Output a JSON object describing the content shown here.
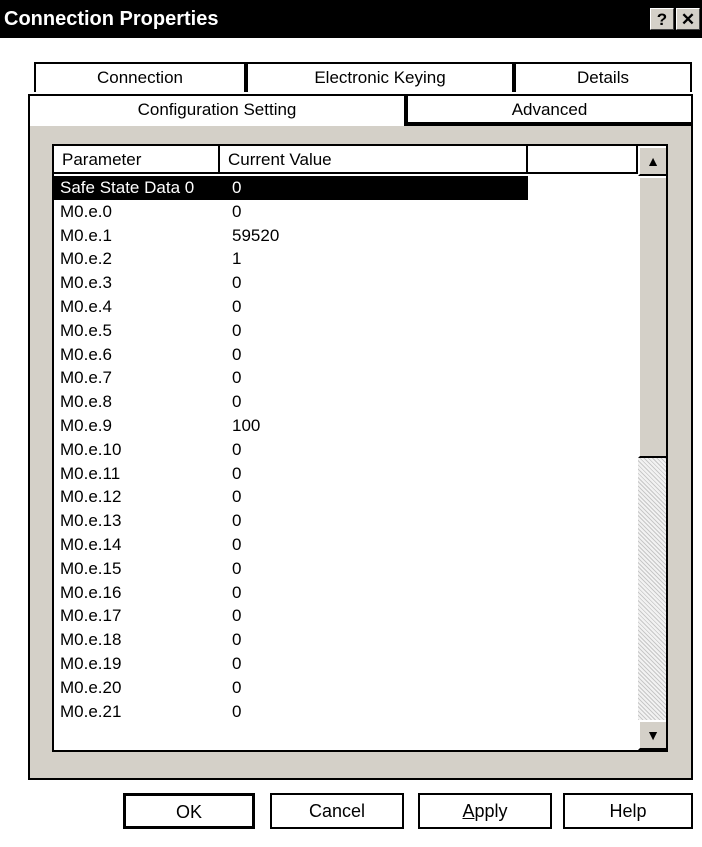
{
  "window": {
    "title": "Connection Properties",
    "help_button": "?",
    "close_button": "✕"
  },
  "tabs_back": [
    {
      "label": "Connection"
    },
    {
      "label": "Electronic Keying"
    },
    {
      "label": "Details"
    }
  ],
  "tabs_front": [
    {
      "label": "Configuration Setting",
      "active": true
    },
    {
      "label": "Advanced",
      "active": false
    }
  ],
  "table": {
    "columns": [
      "Parameter",
      "Current Value"
    ],
    "rows": [
      {
        "param": "Safe State Data 0",
        "value": "0",
        "selected": true
      },
      {
        "param": "M0.e.0",
        "value": "0"
      },
      {
        "param": "M0.e.1",
        "value": "59520"
      },
      {
        "param": "M0.e.2",
        "value": "1"
      },
      {
        "param": "M0.e.3",
        "value": "0"
      },
      {
        "param": "M0.e.4",
        "value": "0"
      },
      {
        "param": "M0.e.5",
        "value": "0"
      },
      {
        "param": "M0.e.6",
        "value": "0"
      },
      {
        "param": "M0.e.7",
        "value": "0"
      },
      {
        "param": "M0.e.8",
        "value": "0"
      },
      {
        "param": "M0.e.9",
        "value": "100"
      },
      {
        "param": "M0.e.10",
        "value": "0"
      },
      {
        "param": "M0.e.11",
        "value": "0"
      },
      {
        "param": "M0.e.12",
        "value": "0"
      },
      {
        "param": "M0.e.13",
        "value": "0"
      },
      {
        "param": "M0.e.14",
        "value": "0"
      },
      {
        "param": "M0.e.15",
        "value": "0"
      },
      {
        "param": "M0.e.16",
        "value": "0"
      },
      {
        "param": "M0.e.17",
        "value": "0"
      },
      {
        "param": "M0.e.18",
        "value": "0"
      },
      {
        "param": "M0.e.19",
        "value": "0"
      },
      {
        "param": "M0.e.20",
        "value": "0"
      },
      {
        "param": "M0.e.21",
        "value": "0"
      }
    ]
  },
  "scrollbar": {
    "up_icon": "▲",
    "down_icon": "▼"
  },
  "buttons": {
    "ok": "OK",
    "cancel": "Cancel",
    "apply_mnemonic": "A",
    "apply_rest": "pply",
    "help": "Help"
  }
}
